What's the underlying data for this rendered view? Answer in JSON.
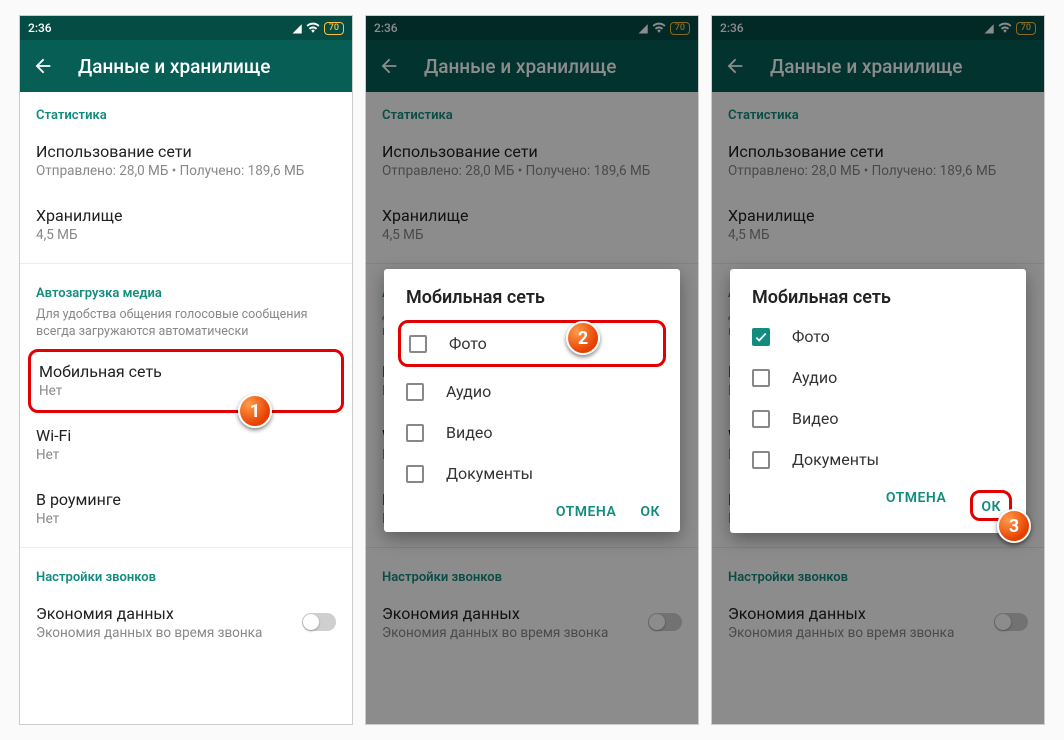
{
  "status": {
    "time": "2:36",
    "battery": "70"
  },
  "header": {
    "title": "Данные и хранилище"
  },
  "sections": {
    "stats": "Статистика",
    "autoload": "Автозагрузка медиа",
    "autoload_help": "Для удобства общения голосовые сообщения всегда загружаются автоматически",
    "calls": "Настройки звонков"
  },
  "items": {
    "network": {
      "title": "Использование сети",
      "sub": "Отправлено: 28,0 МБ • Получено: 189,6 МБ"
    },
    "storage": {
      "title": "Хранилище",
      "sub": "4,5 МБ"
    },
    "mobile": {
      "title": "Мобильная сеть",
      "sub": "Нет"
    },
    "wifi": {
      "title": "Wi-Fi",
      "sub": "Нет"
    },
    "roaming": {
      "title": "В роуминге",
      "sub": "Нет"
    },
    "lowdata": {
      "title": "Экономия данных",
      "sub": "Экономия данных во время звонка"
    }
  },
  "dialog": {
    "title": "Мобильная сеть",
    "opts": {
      "photo": "Фото",
      "audio": "Аудио",
      "video": "Видео",
      "docs": "Документы"
    },
    "cancel": "ОТМЕНА",
    "ok": "ОК"
  },
  "badges": {
    "one": "1",
    "two": "2",
    "three": "3"
  }
}
